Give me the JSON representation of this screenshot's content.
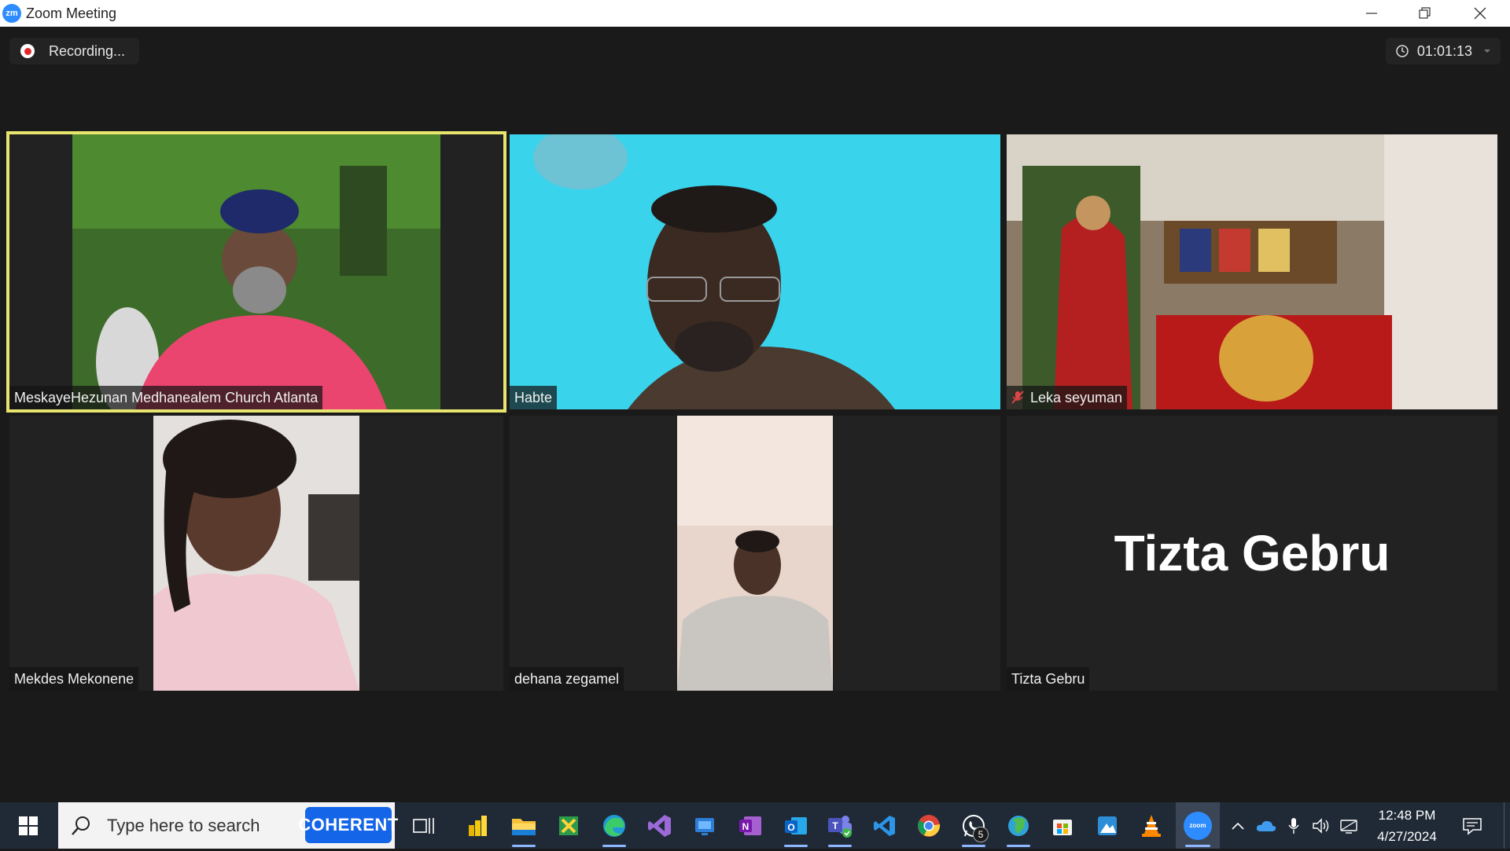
{
  "window": {
    "app_logo": "zm",
    "title": "Zoom Meeting"
  },
  "toolbar": {
    "recording_label": "Recording...",
    "timer": "01:01:13"
  },
  "participants": [
    {
      "name": "MeskayeHezunan Medhanealem Church Atlanta",
      "active_speaker": true,
      "muted": false
    },
    {
      "name": "Habte",
      "active_speaker": false,
      "muted": false
    },
    {
      "name": "Leka seyuman",
      "active_speaker": false,
      "muted": true
    },
    {
      "name": "Mekdes Mekonene",
      "active_speaker": false,
      "muted": false
    },
    {
      "name": "dehana zegamel",
      "active_speaker": false,
      "muted": false
    },
    {
      "name": "Tizta Gebru",
      "active_speaker": false,
      "muted": false,
      "video_off": true,
      "display_name": "Tizta Gebru"
    }
  ],
  "taskbar": {
    "search_placeholder": "Type here to search",
    "search_badge": "COHERENT",
    "apps": [
      "task-view",
      "power-bi",
      "file-explorer",
      "excel-like",
      "edge",
      "visual-studio",
      "remote-desktop",
      "onenote",
      "outlook",
      "teams",
      "vscode",
      "chrome",
      "whatsapp",
      "globe-app",
      "store",
      "paint-app",
      "vlc",
      "zoom"
    ],
    "whatsapp_badge": "5",
    "zoom_label": "zoom",
    "time": "12:48 PM",
    "date": "4/27/2024"
  },
  "colors": {
    "active_border": "#e8e56e",
    "record_red": "#e02828",
    "taskbar_bg": "#202a36",
    "zoom_blue": "#2d8cff"
  }
}
